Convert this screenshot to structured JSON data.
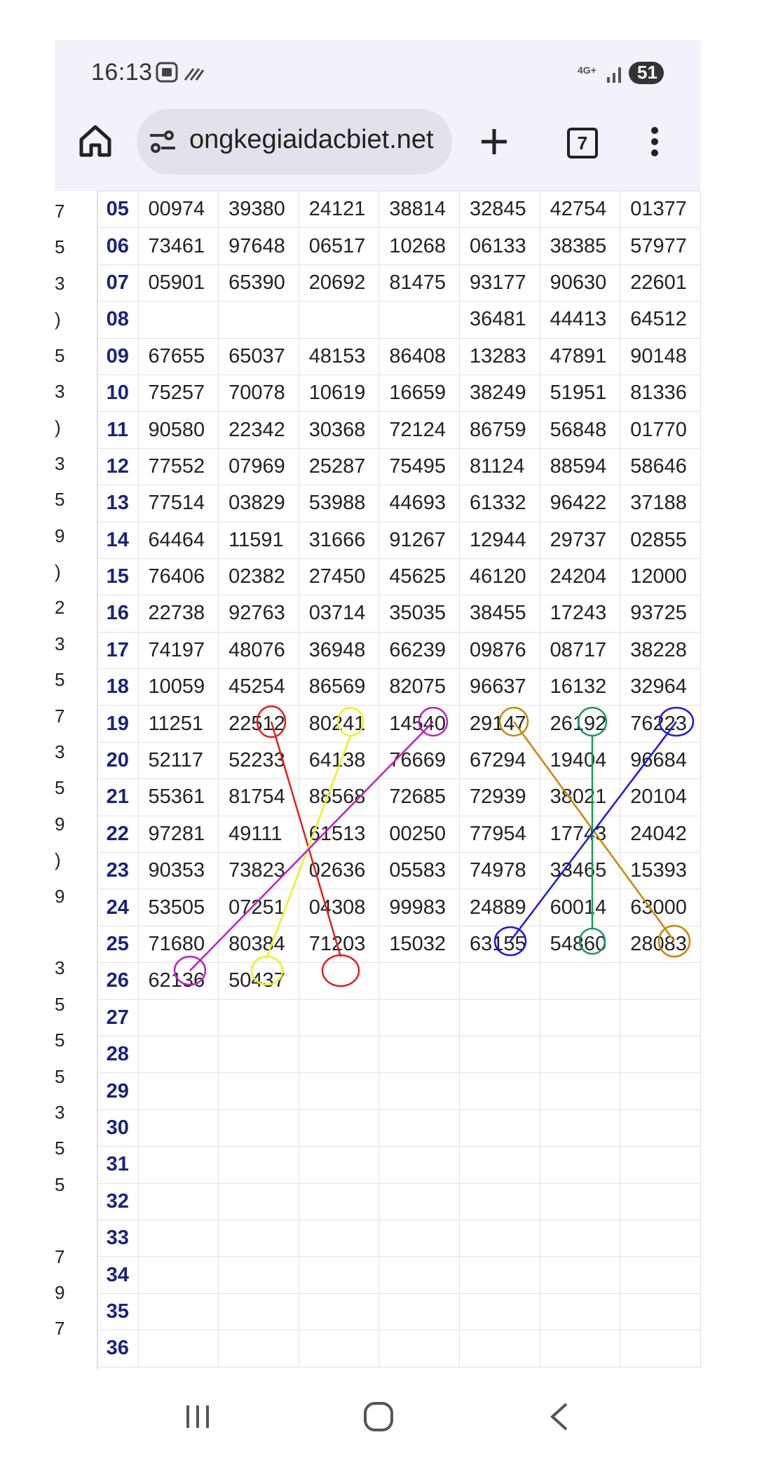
{
  "status": {
    "time": "16:13",
    "network": "4G+",
    "battery": "51"
  },
  "browser": {
    "url": "ongkegiaidacbiet.net",
    "tab_count": "7"
  },
  "left_column_fragments": [
    "7",
    "5",
    "3",
    ")",
    "5",
    "3",
    ")",
    "3",
    "5",
    "9",
    ")",
    "2",
    "3",
    "5",
    "7",
    "3",
    "5",
    "9",
    ")",
    "9",
    "",
    "3",
    "5",
    "5",
    "5",
    "3",
    "5",
    "5",
    "",
    "7",
    "9",
    "7"
  ],
  "table": {
    "rows": [
      {
        "day": "05",
        "values": [
          "00974",
          "39380",
          "24121",
          "38814",
          "32845",
          "42754",
          "01377"
        ]
      },
      {
        "day": "06",
        "values": [
          "73461",
          "97648",
          "06517",
          "10268",
          "06133",
          "38385",
          "57977"
        ]
      },
      {
        "day": "07",
        "values": [
          "05901",
          "65390",
          "20692",
          "81475",
          "93177",
          "90630",
          "22601"
        ]
      },
      {
        "day": "08",
        "values": [
          "",
          "",
          "",
          "",
          "36481",
          "44413",
          "64512"
        ]
      },
      {
        "day": "09",
        "values": [
          "67655",
          "65037",
          "48153",
          "86408",
          "13283",
          "47891",
          "90148"
        ]
      },
      {
        "day": "10",
        "values": [
          "75257",
          "70078",
          "10619",
          "16659",
          "38249",
          "51951",
          "81336"
        ]
      },
      {
        "day": "11",
        "values": [
          "90580",
          "22342",
          "30368",
          "72124",
          "86759",
          "56848",
          "01770"
        ]
      },
      {
        "day": "12",
        "values": [
          "77552",
          "07969",
          "25287",
          "75495",
          "81124",
          "88594",
          "58646"
        ]
      },
      {
        "day": "13",
        "values": [
          "77514",
          "03829",
          "53988",
          "44693",
          "61332",
          "96422",
          "37188"
        ]
      },
      {
        "day": "14",
        "values": [
          "64464",
          "11591",
          "31666",
          "91267",
          "12944",
          "29737",
          "02855"
        ]
      },
      {
        "day": "15",
        "values": [
          "76406",
          "02382",
          "27450",
          "45625",
          "46120",
          "24204",
          "12000"
        ]
      },
      {
        "day": "16",
        "values": [
          "22738",
          "92763",
          "03714",
          "35035",
          "38455",
          "17243",
          "93725"
        ]
      },
      {
        "day": "17",
        "values": [
          "74197",
          "48076",
          "36948",
          "66239",
          "09876",
          "08717",
          "38228"
        ]
      },
      {
        "day": "18",
        "values": [
          "10059",
          "45254",
          "86569",
          "82075",
          "96637",
          "16132",
          "32964"
        ]
      },
      {
        "day": "19",
        "values": [
          "11251",
          "22512",
          "80241",
          "14540",
          "29147",
          "26192",
          "76223"
        ]
      },
      {
        "day": "20",
        "values": [
          "52117",
          "52233",
          "64138",
          "76669",
          "67294",
          "19404",
          "96684"
        ]
      },
      {
        "day": "21",
        "values": [
          "55361",
          "81754",
          "88568",
          "72685",
          "72939",
          "38021",
          "20104"
        ]
      },
      {
        "day": "22",
        "values": [
          "97281",
          "49111",
          "61513",
          "00250",
          "77954",
          "17743",
          "24042"
        ]
      },
      {
        "day": "23",
        "values": [
          "90353",
          "73823",
          "02636",
          "05583",
          "74978",
          "33465",
          "15393"
        ]
      },
      {
        "day": "24",
        "values": [
          "53505",
          "07251",
          "04308",
          "99983",
          "24889",
          "60014",
          "63000"
        ]
      },
      {
        "day": "25",
        "values": [
          "71680",
          "80384",
          "71203",
          "15032",
          "63155",
          "54860",
          "28083"
        ]
      },
      {
        "day": "26",
        "values": [
          "62136",
          "50437",
          "",
          "",
          "",
          "",
          ""
        ]
      },
      {
        "day": "27",
        "values": [
          "",
          "",
          "",
          "",
          "",
          "",
          ""
        ]
      },
      {
        "day": "28",
        "values": [
          "",
          "",
          "",
          "",
          "",
          "",
          ""
        ]
      },
      {
        "day": "29",
        "values": [
          "",
          "",
          "",
          "",
          "",
          "",
          ""
        ]
      },
      {
        "day": "30",
        "values": [
          "",
          "",
          "",
          "",
          "",
          "",
          ""
        ]
      },
      {
        "day": "31",
        "values": [
          "",
          "",
          "",
          "",
          "",
          "",
          ""
        ]
      },
      {
        "day": "32",
        "values": [
          "",
          "",
          "",
          "",
          "",
          "",
          ""
        ]
      },
      {
        "day": "33",
        "values": [
          "",
          "",
          "",
          "",
          "",
          "",
          ""
        ]
      },
      {
        "day": "34",
        "values": [
          "",
          "",
          "",
          "",
          "",
          "",
          ""
        ]
      },
      {
        "day": "35",
        "values": [
          "",
          "",
          "",
          "",
          "",
          "",
          ""
        ]
      },
      {
        "day": "36",
        "values": [
          "",
          "",
          "",
          "",
          "",
          "",
          ""
        ]
      }
    ]
  },
  "annotation_colors": {
    "red": "#e02020",
    "yellow": "#f0f020",
    "magenta": "#c020c0",
    "orange": "#c8860a",
    "green": "#1a9a5a",
    "blue": "#1a1ae0"
  },
  "theme": {
    "day_color": "#1a237e",
    "toolbar_bg": "#f3f1fa"
  }
}
